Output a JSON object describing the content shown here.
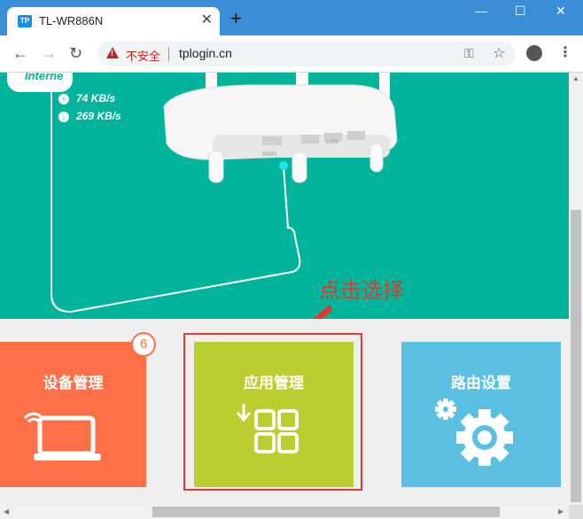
{
  "browser": {
    "tab_favicon": "TP",
    "tab_title": "TL-WR886N",
    "tab_close": "✕",
    "new_tab": "+",
    "window_controls": {
      "minimize": "—",
      "maximize": "☐",
      "close": "✕"
    },
    "nav": {
      "back": "←",
      "forward": "→",
      "reload": "↻"
    },
    "security_label": "不安全",
    "url": "tplogin.cn"
  },
  "page": {
    "net_badge": "Interne",
    "upload_speed": "74 KB/s",
    "download_speed": "269 KB/s",
    "router_ports": {
      "wan": "WAN",
      "lan": "LAN"
    },
    "annotation": "点击选择",
    "tiles": [
      {
        "label": "设备管理",
        "badge": "6"
      },
      {
        "label": "应用管理"
      },
      {
        "label": "路由设置"
      }
    ]
  },
  "colors": {
    "hero": "#00b39b",
    "device_tile": "#fe7148",
    "app_tile": "#b9cf2f",
    "route_tile": "#5bbfe1",
    "annotation": "#e03b2e"
  }
}
